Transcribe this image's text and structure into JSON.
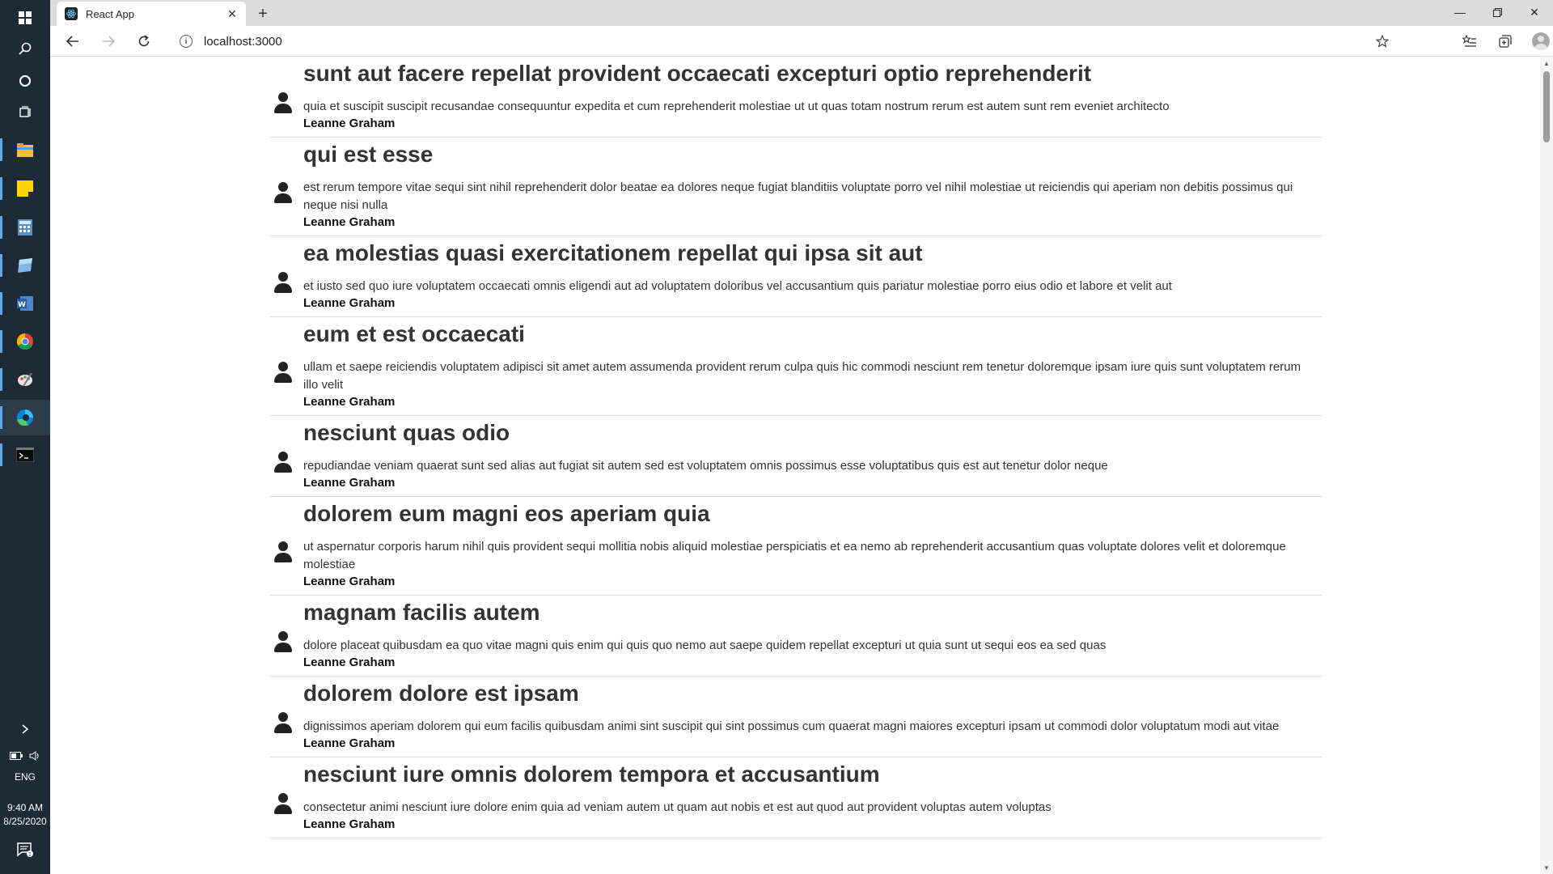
{
  "taskbar": {
    "time": "9:40 AM",
    "date": "8/25/2020",
    "language": "ENG"
  },
  "browser": {
    "tab_title": "React App",
    "url": "localhost:3000"
  },
  "posts": [
    {
      "title": "sunt aut facere repellat provident occaecati excepturi optio reprehenderit",
      "body": "quia et suscipit suscipit recusandae consequuntur expedita et cum reprehenderit molestiae ut ut quas totam nostrum rerum est autem sunt rem eveniet architecto",
      "author": "Leanne Graham"
    },
    {
      "title": "qui est esse",
      "body": "est rerum tempore vitae sequi sint nihil reprehenderit dolor beatae ea dolores neque fugiat blanditiis voluptate porro vel nihil molestiae ut reiciendis qui aperiam non debitis possimus qui neque nisi nulla",
      "author": "Leanne Graham"
    },
    {
      "title": "ea molestias quasi exercitationem repellat qui ipsa sit aut",
      "body": "et iusto sed quo iure voluptatem occaecati omnis eligendi aut ad voluptatem doloribus vel accusantium quis pariatur molestiae porro eius odio et labore et velit aut",
      "author": "Leanne Graham"
    },
    {
      "title": "eum et est occaecati",
      "body": "ullam et saepe reiciendis voluptatem adipisci sit amet autem assumenda provident rerum culpa quis hic commodi nesciunt rem tenetur doloremque ipsam iure quis sunt voluptatem rerum illo velit",
      "author": "Leanne Graham"
    },
    {
      "title": "nesciunt quas odio",
      "body": "repudiandae veniam quaerat sunt sed alias aut fugiat sit autem sed est voluptatem omnis possimus esse voluptatibus quis est aut tenetur dolor neque",
      "author": "Leanne Graham"
    },
    {
      "title": "dolorem eum magni eos aperiam quia",
      "body": "ut aspernatur corporis harum nihil quis provident sequi mollitia nobis aliquid molestiae perspiciatis et ea nemo ab reprehenderit accusantium quas voluptate dolores velit et doloremque molestiae",
      "author": "Leanne Graham"
    },
    {
      "title": "magnam facilis autem",
      "body": "dolore placeat quibusdam ea quo vitae magni quis enim qui quis quo nemo aut saepe quidem repellat excepturi ut quia sunt ut sequi eos ea sed quas",
      "author": "Leanne Graham"
    },
    {
      "title": "dolorem dolore est ipsam",
      "body": "dignissimos aperiam dolorem qui eum facilis quibusdam animi sint suscipit qui sint possimus cum quaerat magni maiores excepturi ipsam ut commodi dolor voluptatum modi aut vitae",
      "author": "Leanne Graham"
    },
    {
      "title": "nesciunt iure omnis dolorem tempora et accusantium",
      "body": "consectetur animi nesciunt iure dolore enim quia ad veniam autem ut quam aut nobis et est aut quod aut provident voluptas autem voluptas",
      "author": "Leanne Graham"
    }
  ]
}
